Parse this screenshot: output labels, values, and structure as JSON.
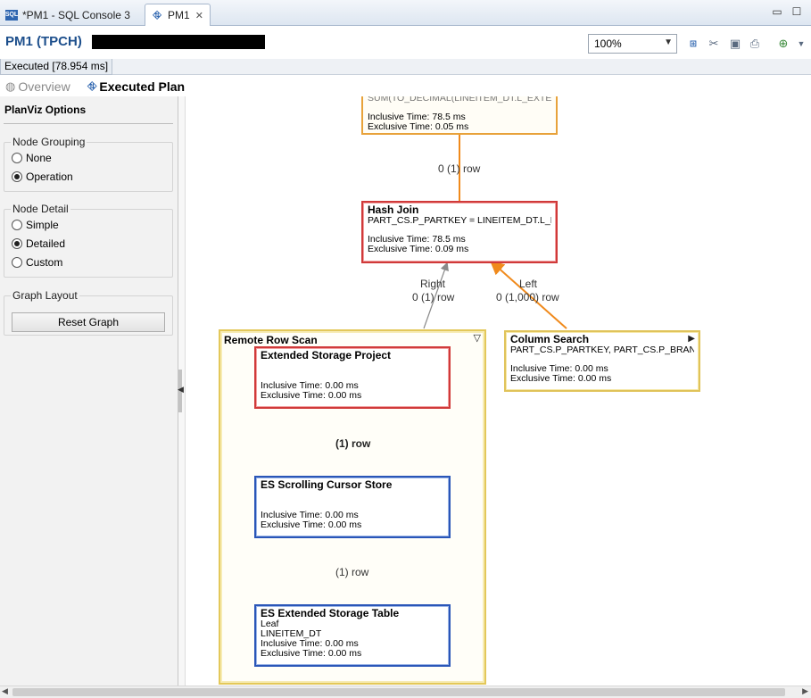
{
  "tabs": [
    {
      "label": "*PM1 - SQL Console 3",
      "icon": "sql-icon",
      "active": false
    },
    {
      "label": "PM1",
      "icon": "plan-icon",
      "active": true
    }
  ],
  "header": {
    "title": "PM1 (TPCH)",
    "zoom": "100%"
  },
  "status": {
    "text": "Executed [78.954 ms]"
  },
  "view_tabs": {
    "overview": "Overview",
    "executed_plan": "Executed Plan"
  },
  "options": {
    "title": "PlanViz Options",
    "node_grouping": {
      "label": "Node Grouping",
      "options": [
        "None",
        "Operation"
      ],
      "selected": "Operation"
    },
    "node_detail": {
      "label": "Node Detail",
      "options": [
        "Simple",
        "Detailed",
        "Custom"
      ],
      "selected": "Detailed"
    },
    "graph_layout": {
      "label": "Graph Layout",
      "reset_button": "Reset Graph"
    }
  },
  "graph": {
    "top_node": {
      "detail": "SUM(TO_DECIMAL(LINEITEM_DT.L_EXTEN...",
      "inclusive": "Inclusive Time: 78.5 ms",
      "exclusive": "Exclusive Time: 0.05 ms"
    },
    "hash_join": {
      "title": "Hash Join",
      "detail": "PART_CS.P_PARTKEY = LINEITEM_DT.L_PA...",
      "inclusive": "Inclusive Time: 78.5 ms",
      "exclusive": "Exclusive Time: 0.09 ms"
    },
    "column_search": {
      "title": "Column Search",
      "detail": "PART_CS.P_PARTKEY, PART_CS.P_BRAND, ...",
      "inclusive": "Inclusive Time: 0.00 ms",
      "exclusive": "Exclusive Time: 0.00 ms"
    },
    "remote_row_scan": {
      "title": "Remote Row Scan"
    },
    "es_project": {
      "title": "Extended Storage Project",
      "inclusive": "Inclusive Time: 0.00 ms",
      "exclusive": "Exclusive Time: 0.00 ms"
    },
    "es_cursor": {
      "title": "ES Scrolling Cursor Store",
      "inclusive": "Inclusive Time: 0.00 ms",
      "exclusive": "Exclusive Time: 0.00 ms"
    },
    "es_table": {
      "title": "ES Extended Storage Table",
      "line1": "Leaf",
      "line2": "LINEITEM_DT",
      "inclusive": "Inclusive Time: 0.00 ms",
      "exclusive": "Exclusive Time: 0.00 ms"
    },
    "edges": {
      "top_rows": "0 (1) row",
      "right_side": "Right",
      "right_rows": "0 (1) row",
      "left_side": "Left",
      "left_rows": "0 (1,000) row",
      "cursor_to_project": "(1) row",
      "table_to_cursor": "(1) row"
    },
    "colors": {
      "orange_edge": "#f08a1c",
      "red_edge": "#e02020",
      "gray_edge": "#8a8a8a"
    }
  }
}
